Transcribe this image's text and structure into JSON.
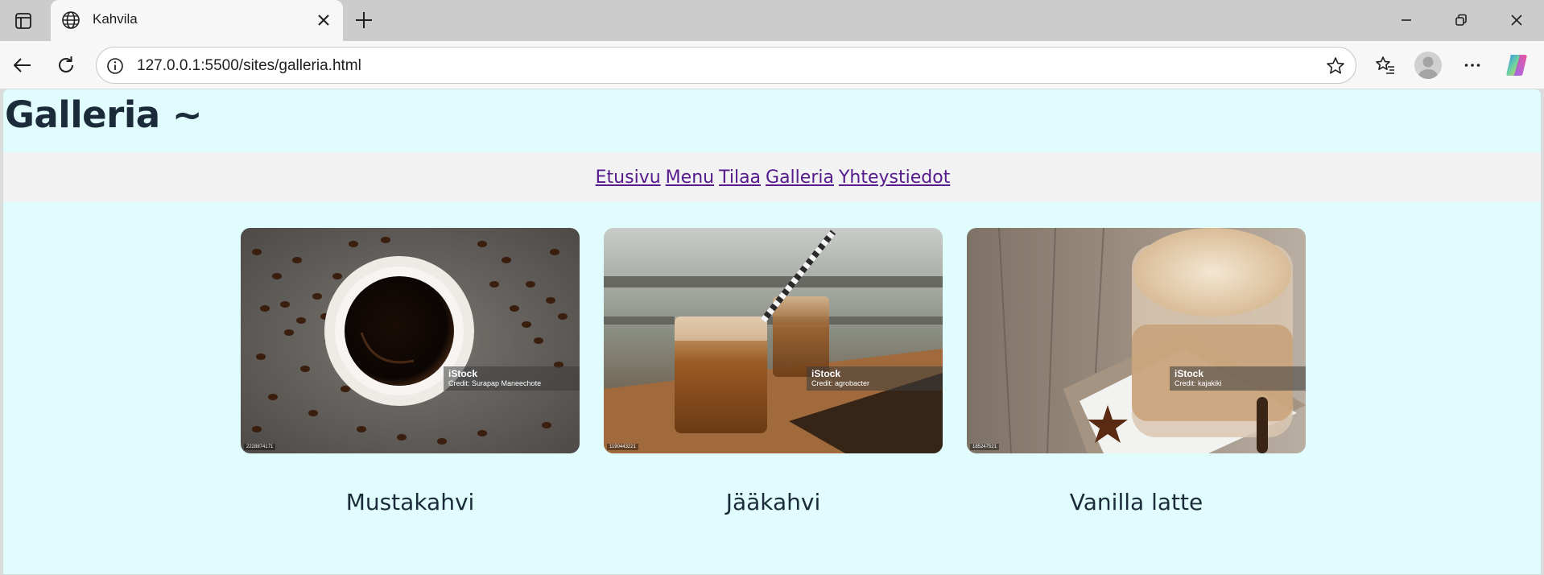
{
  "browser": {
    "tab_title": "Kahvila",
    "url": "127.0.0.1:5500/sites/galleria.html"
  },
  "page": {
    "title": "Galleria ~",
    "nav": [
      "Etusivu",
      "Menu",
      "Tilaa",
      "Galleria",
      "Yhteystiedot"
    ]
  },
  "gallery": [
    {
      "caption": "Mustakahvi",
      "image": "black-coffee-cup-with-beans",
      "watermark": "iStock",
      "credit": "Credit: Surapap Maneechote",
      "stock_id": "2228874171"
    },
    {
      "caption": "Jääkahvi",
      "image": "iced-coffee-glasses-with-straw",
      "watermark": "iStock",
      "credit": "Credit: agrobacter",
      "stock_id": "1190443221"
    },
    {
      "caption": "Vanilla latte",
      "image": "latte-glass-with-star-anise",
      "watermark": "iStock",
      "credit": "Credit: kajakiki",
      "stock_id": "185247521"
    }
  ],
  "icons": {
    "tab_actions": "tab-actions-icon",
    "globe": "globe-icon",
    "close": "close-icon",
    "new_tab": "plus-icon",
    "back": "back-arrow-icon",
    "reload": "reload-icon",
    "info": "info-icon",
    "favorite": "star-icon",
    "favorites": "favorites-icon",
    "profile": "avatar",
    "more": "more-icon",
    "copilot": "copilot-icon"
  },
  "colors": {
    "page_background": "#e1fcfc",
    "nav_background": "#f2f2f2",
    "link_color": "#551a8b",
    "title_color": "#1c2b3a"
  }
}
